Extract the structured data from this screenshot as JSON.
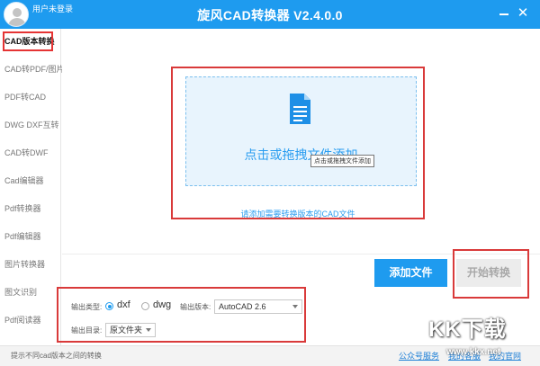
{
  "header": {
    "user_label": "用户未登录",
    "title": "旋风CAD转换器 V2.4.0.0",
    "minimize_icon": "minimize-icon",
    "close_glyph": "✕",
    "color": "#1e9bef"
  },
  "sidebar": {
    "items": [
      {
        "label": "CAD版本转换",
        "active": true
      },
      {
        "label": "CAD转PDF/图片",
        "active": false
      },
      {
        "label": "PDF转CAD",
        "active": false
      },
      {
        "label": "DWG DXF互转",
        "active": false
      },
      {
        "label": "CAD转DWF",
        "active": false
      },
      {
        "label": "Cad编辑器",
        "active": false
      },
      {
        "label": "Pdf转换器",
        "active": false
      },
      {
        "label": "Pdf编辑器",
        "active": false
      },
      {
        "label": "图片转换器",
        "active": false
      },
      {
        "label": "图文识别",
        "active": false
      },
      {
        "label": "Pdf阅读器",
        "active": false
      }
    ]
  },
  "drop_area": {
    "icon": "document-file-icon",
    "text": "点击或拖拽文件添加",
    "tooltip": "点击或拖拽文件添加",
    "hint": "请添加需要转换版本的CAD文件"
  },
  "actions": {
    "add_file": "添加文件",
    "start": "开始转换"
  },
  "options": {
    "output_type_label": "输出类型:",
    "types": [
      {
        "label": "dxf",
        "checked": true
      },
      {
        "label": "dwg",
        "checked": false
      }
    ],
    "version_label": "输出版本:",
    "version_value": "AutoCAD 2.6",
    "dir_label": "输出目录:",
    "dir_value": "原文件夹"
  },
  "status": {
    "text": "提示不同cad版本之间的转换",
    "links": [
      "公众号服务",
      "我的客服",
      "我的官网"
    ]
  },
  "watermark": {
    "text": "KK下载",
    "sub": "www.kkx.net"
  },
  "colors": {
    "accent": "#1e9bef",
    "highlight_frame": "#d93a3a",
    "drop_bg": "#e8f4fd"
  }
}
